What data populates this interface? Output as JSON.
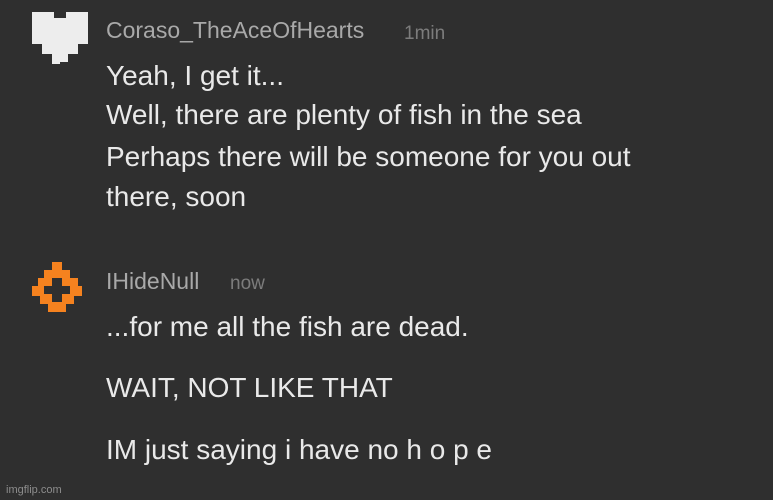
{
  "comments": [
    {
      "username": "Coraso_TheAceOfHearts",
      "timestamp": "1min",
      "avatar_icon": "white-pixel-heart-icon",
      "avatar_color": "#ededed",
      "lines": [
        "Yeah, I get it...",
        "Well, there are plenty of fish in the sea",
        "Perhaps there will be someone for you out",
        "there, soon"
      ]
    },
    {
      "username": "IHideNull",
      "timestamp": "now",
      "avatar_icon": "orange-pixel-diamond-icon",
      "avatar_color": "#f5821f",
      "lines": [
        "...for me all the fish are dead.",
        "WAIT, NOT LIKE THAT",
        "IM just saying i have no h o p e"
      ]
    }
  ],
  "watermark": "imgflip.com"
}
